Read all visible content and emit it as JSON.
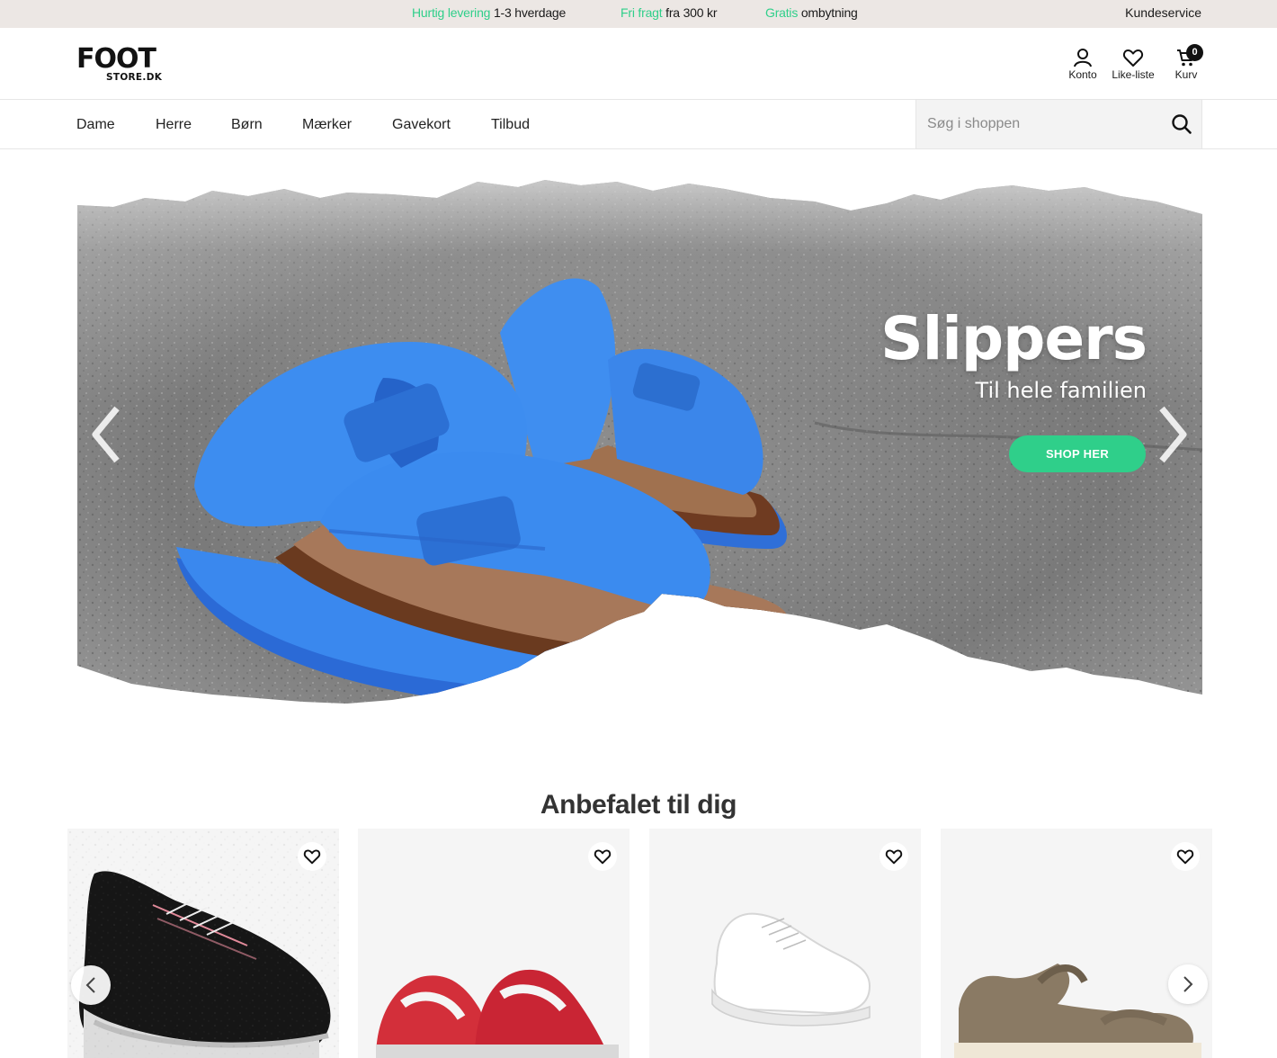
{
  "topbar": {
    "usp1_green": "Hurtig levering",
    "usp1_dark": "1-3 hverdage",
    "usp2_green": "Fri fragt",
    "usp2_dark": "fra 300 kr",
    "usp3_green": "Gratis",
    "usp3_dark": "ombytning",
    "customer_service": "Kundeservice"
  },
  "logo": {
    "line1": "FOOT",
    "line2": "STORE.DK"
  },
  "header": {
    "account_label": "Konto",
    "wishlist_label": "Like-liste",
    "cart_label": "Kurv",
    "cart_count": "0"
  },
  "nav": {
    "items": [
      "Dame",
      "Herre",
      "Børn",
      "Mærker",
      "Gavekort",
      "Tilbud"
    ]
  },
  "search": {
    "placeholder": "Søg i shoppen"
  },
  "hero": {
    "title": "Slippers",
    "subtitle": "Til hele familien",
    "cta": "SHOP HER"
  },
  "recommended": {
    "title": "Anbefalet til dig"
  },
  "colors": {
    "accent_green": "#2fcf8a",
    "topbar_bg": "#ece7e4",
    "card_bg": "#f5f5f5"
  },
  "icons": [
    "account-icon",
    "heart-icon",
    "cart-icon",
    "search-icon",
    "chevron-left-icon",
    "chevron-right-icon"
  ]
}
